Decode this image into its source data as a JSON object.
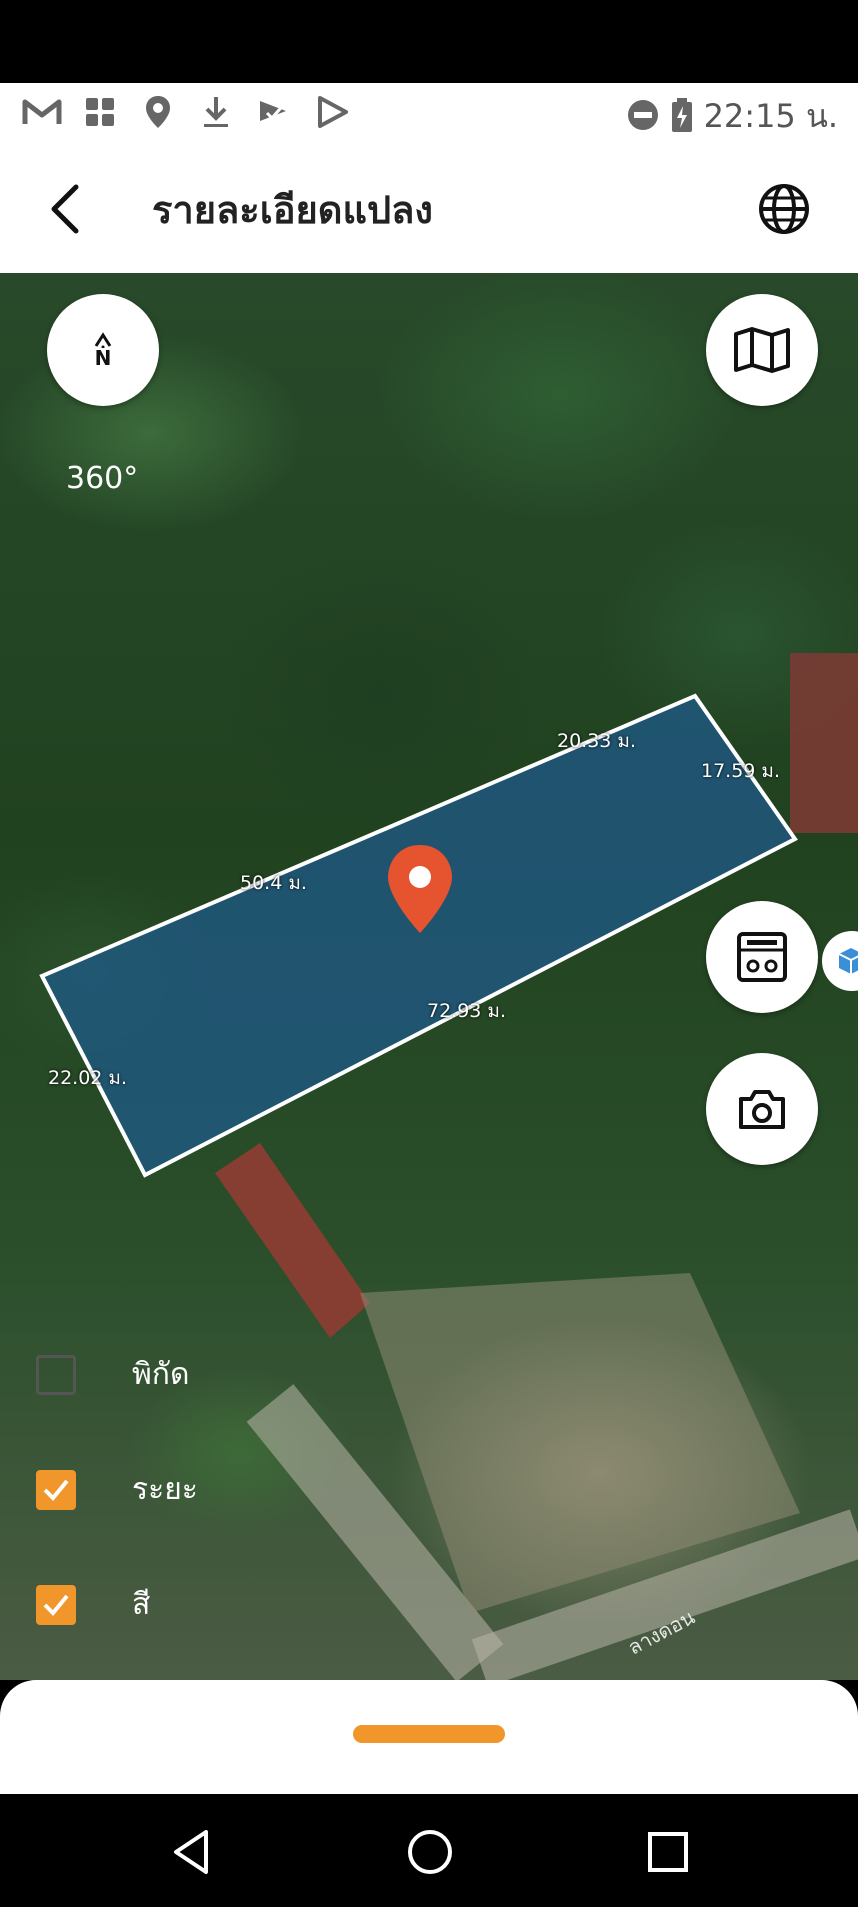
{
  "status_bar": {
    "time": "22:15 น.",
    "left_icons": [
      "gmail-icon",
      "sim-card-icon",
      "location-pin-icon",
      "download-icon",
      "check-flag-icon",
      "play-store-icon"
    ],
    "right_icons": [
      "do-not-disturb-icon",
      "battery-charging-icon"
    ]
  },
  "appbar": {
    "title": "รายละเอียดแปลง",
    "back_icon": "arrow-back-icon",
    "globe_icon": "globe-icon"
  },
  "map": {
    "compass_label": "N",
    "heading": "360°",
    "dimensions": {
      "top": "20.33 ม.",
      "right": "17.59 ม.",
      "left_upper": "50.4 ม.",
      "bottom": "72.93 ม.",
      "left": "22.02 ม."
    },
    "parcel_fill_color": "#1f5a8e",
    "pin_color": "#e5532f",
    "street_label": "ลางดอน",
    "buttons": [
      "map-layers-icon",
      "calculator-icon",
      "camera-icon",
      "3d-cube-icon"
    ]
  },
  "layers": [
    {
      "label": "พิกัด",
      "checked": false
    },
    {
      "label": "ระยะ",
      "checked": true
    },
    {
      "label": "สี",
      "checked": true
    }
  ],
  "accent_color": "#f0962a"
}
